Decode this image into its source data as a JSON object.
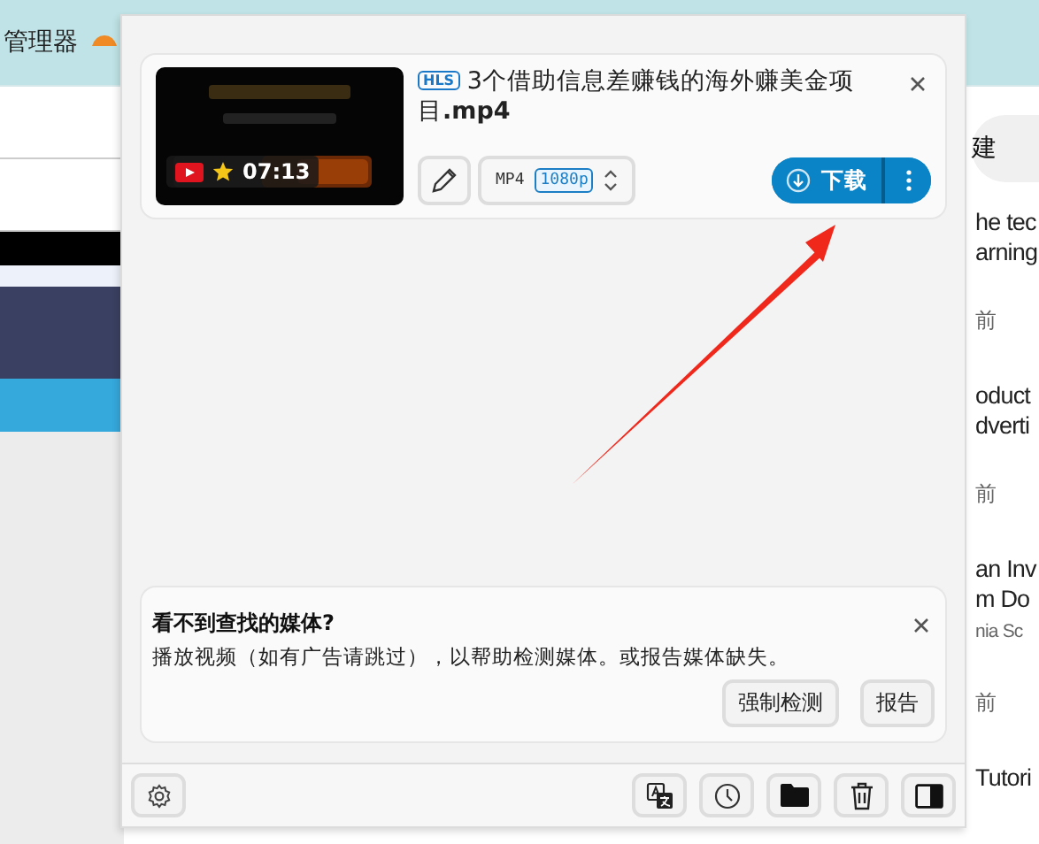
{
  "background_page": {
    "toolbar_text": "管理器",
    "side_button_text": "建",
    "right_lines": [
      {
        "kind": "title",
        "text": "he tec"
      },
      {
        "kind": "title",
        "text": "arning"
      },
      {
        "kind": "meta",
        "text": "前"
      },
      {
        "kind": "title",
        "text": "oduct"
      },
      {
        "kind": "title",
        "text": "dverti"
      },
      {
        "kind": "meta",
        "text": "前"
      },
      {
        "kind": "title",
        "text": "an Inv"
      },
      {
        "kind": "title",
        "text": "m Do"
      },
      {
        "kind": "sub",
        "text": "nia Sc"
      },
      {
        "kind": "meta",
        "text": "前"
      },
      {
        "kind": "title",
        "text": "Tutori"
      }
    ]
  },
  "media_item": {
    "stream_badge": "HLS",
    "title": "3个借助信息差赚钱的海外赚美金项目**.mp4**",
    "duration": "07:13",
    "format": "MP4",
    "quality": "1080p",
    "download_label": "下载"
  },
  "notice": {
    "title": "看不到查找的媒体?",
    "text": "播放视频（如有广告请跳过），以帮助检测媒体。或报告媒体缺失。",
    "buttons": [
      "强制检测",
      "报告"
    ]
  }
}
